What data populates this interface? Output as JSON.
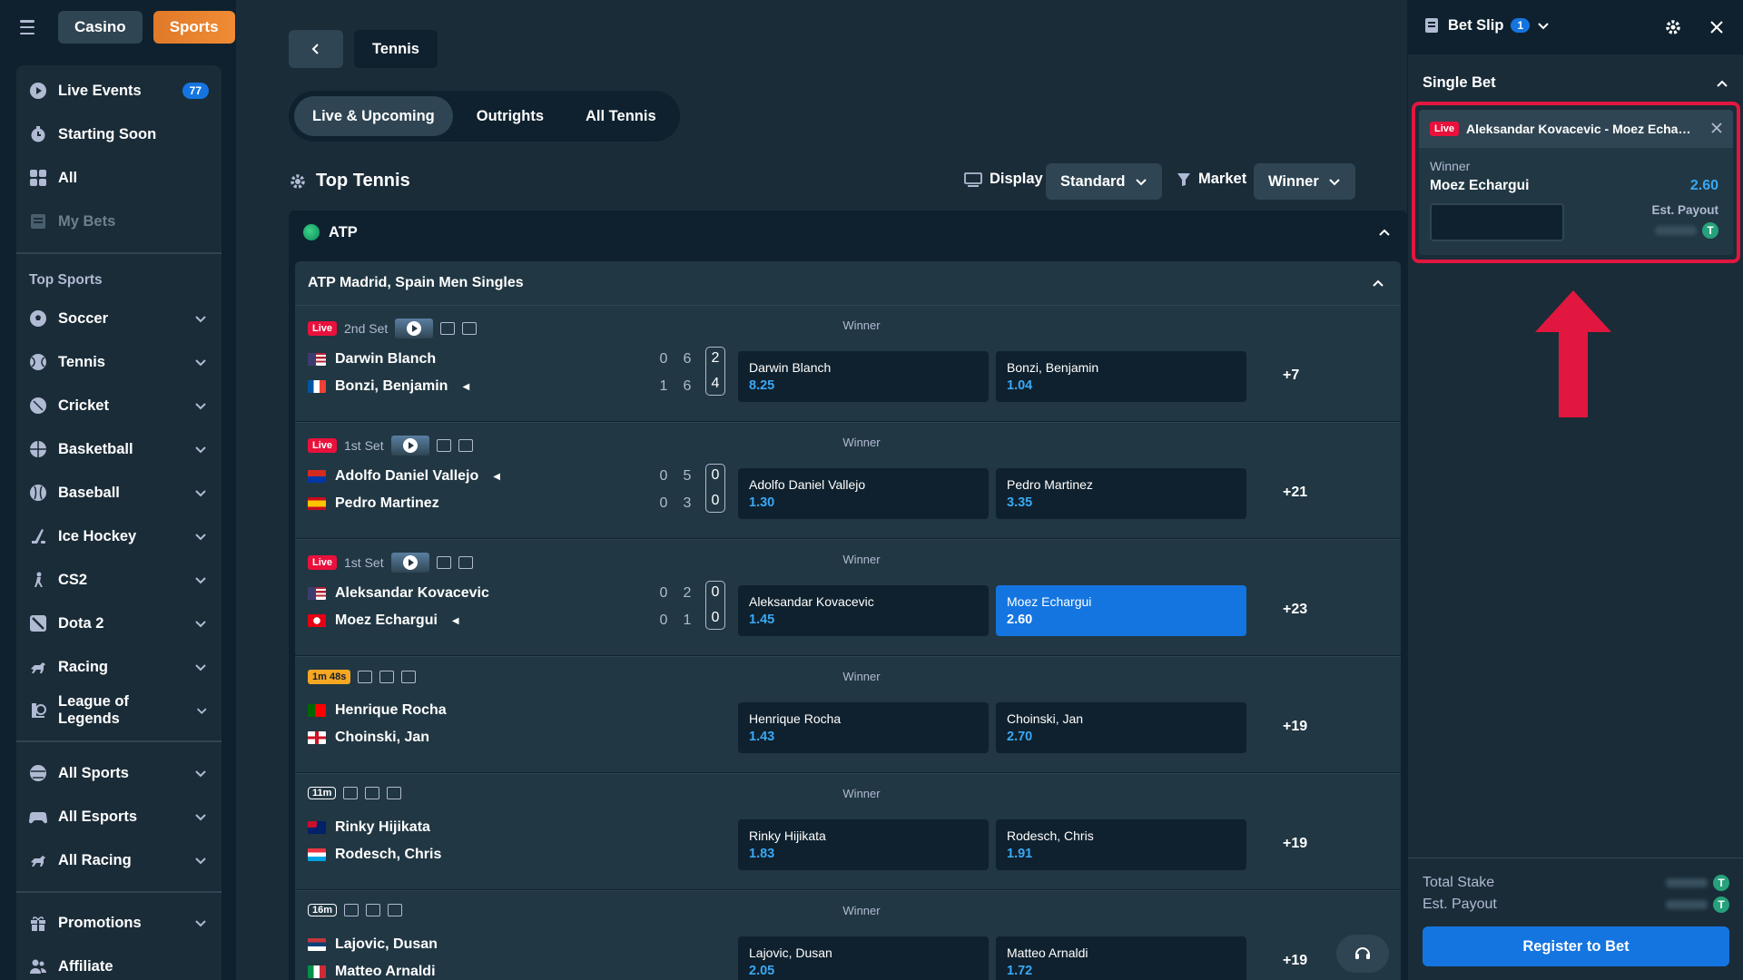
{
  "header": {
    "casino_label": "Casino",
    "sports_label": "Sports"
  },
  "sidebar": {
    "live_events": {
      "label": "Live Events",
      "badge": "77"
    },
    "starting_soon": "Starting Soon",
    "all": "All",
    "my_bets": "My Bets",
    "top_sports_heading": "Top Sports",
    "sports": [
      "Soccer",
      "Tennis",
      "Cricket",
      "Basketball",
      "Baseball",
      "Ice Hockey",
      "CS2",
      "Dota 2",
      "Racing",
      "League of Legends"
    ],
    "all_sports": "All Sports",
    "all_esports": "All Esports",
    "all_racing": "All Racing",
    "promotions": "Promotions",
    "affiliate": "Affiliate"
  },
  "main": {
    "breadcrumb": "Tennis",
    "tabs": [
      "Live & Upcoming",
      "Outrights",
      "All Tennis"
    ],
    "section_title": "Top Tennis",
    "display_label": "Display",
    "display_value": "Standard",
    "market_label": "Market",
    "market_value": "Winner",
    "league": "ATP",
    "tournament": "ATP Madrid, Spain Men Singles",
    "market_name": "Winner",
    "matches": [
      {
        "status": "Live",
        "period": "2nd Set",
        "p1": "Darwin Blanch",
        "p2": "Bonzi, Benjamin",
        "s1": [
          "0",
          "6",
          "2"
        ],
        "s2": [
          "1",
          "6",
          "4"
        ],
        "o1": "8.25",
        "o2": "1.04",
        "more": "+7"
      },
      {
        "status": "Live",
        "period": "1st Set",
        "p1": "Adolfo Daniel Vallejo",
        "p2": "Pedro Martinez",
        "s1": [
          "0",
          "5",
          "0"
        ],
        "s2": [
          "0",
          "3",
          "0"
        ],
        "o1": "1.30",
        "o2": "3.35",
        "more": "+21"
      },
      {
        "status": "Live",
        "period": "1st Set",
        "p1": "Aleksandar Kovacevic",
        "p2": "Moez Echargui",
        "s1": [
          "0",
          "2",
          "0"
        ],
        "s2": [
          "0",
          "1",
          "0"
        ],
        "o1": "1.45",
        "o2": "2.60",
        "more": "+23"
      },
      {
        "time": "1m 48s",
        "p1": "Henrique Rocha",
        "p2": "Choinski, Jan",
        "o1": "1.43",
        "o2": "2.70",
        "more": "+19"
      },
      {
        "time": "11m",
        "p1": "Rinky Hijikata",
        "p2": "Rodesch, Chris",
        "o1": "1.83",
        "o2": "1.91",
        "more": "+19"
      },
      {
        "time": "16m",
        "p1": "Lajovic, Dusan",
        "p2": "Matteo Arnaldi",
        "o1": "2.05",
        "o2": "1.72",
        "more": "+19"
      }
    ]
  },
  "betslip": {
    "title": "Bet Slip",
    "count": "1",
    "mode": "Single Bet",
    "bet": {
      "status": "Live",
      "event": "Aleksandar Kovacevic - Moez Echargui",
      "market": "Winner",
      "selection": "Moez Echargui",
      "odds": "2.60",
      "payout_label": "Est. Payout"
    },
    "total_stake_label": "Total Stake",
    "est_payout_label": "Est. Payout",
    "register_label": "Register to Bet"
  },
  "colors": {
    "accent": "#1475e1",
    "odds": "#3aa8f4",
    "live": "#e9113c",
    "highlight": "#e1173f"
  }
}
